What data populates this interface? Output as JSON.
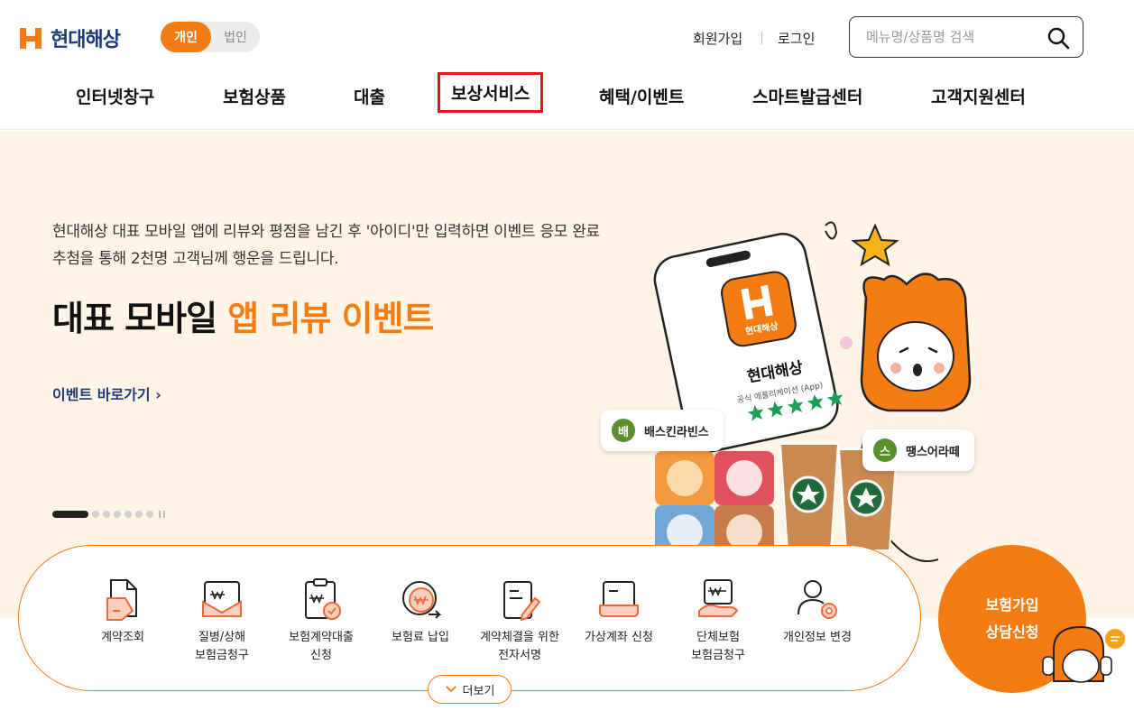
{
  "brand": {
    "name": "현대해상",
    "color": "#f47c12",
    "navy": "#1d3c78"
  },
  "segment": {
    "personal": "개인",
    "corporate": "법인"
  },
  "utility": {
    "join": "회원가입",
    "login": "로그인"
  },
  "search": {
    "placeholder": "메뉴명/상품명 검색",
    "icon": "search-icon"
  },
  "gnb": [
    {
      "label": "인터넷창구"
    },
    {
      "label": "보험상품"
    },
    {
      "label": "대출"
    },
    {
      "label": "보상서비스"
    },
    {
      "label": "혜택/이벤트"
    },
    {
      "label": "스마트발급센터"
    },
    {
      "label": "고객지원센터"
    }
  ],
  "hero": {
    "desc_line1": "현대해상 대표 모바일 앱에 리뷰와 평점을 남긴 후 '아이디'만 입력하면 이벤트 응모 완료",
    "desc_line2": "추첨을 통해 2천명 고객님께 행운을 드립니다.",
    "title_plain": "대표 모바일 ",
    "title_accent": "앱 리뷰 이벤트",
    "link": "이벤트 바로가기",
    "slide_count": 8,
    "current_slide": 1,
    "art": {
      "app_name": "현대해상",
      "app_sub": "공식 애플리케이션 (App)",
      "logo_text": "현대해상",
      "rating_stars": 5,
      "chip1": {
        "initial": "배",
        "label": "배스킨라빈스"
      },
      "chip2": {
        "initial": "스",
        "label": "땡스어라떼"
      }
    }
  },
  "quick_menu": [
    {
      "label": "계약조회",
      "icon": "document-icon"
    },
    {
      "label": "질병/상해\n보험금청구",
      "icon": "won-envelope-icon"
    },
    {
      "label": "보험계약대출\n신청",
      "icon": "clipboard-won-icon"
    },
    {
      "label": "보험료 납입",
      "icon": "won-payment-icon"
    },
    {
      "label": "계약체결을 위한\n전자서명",
      "icon": "sign-document-icon"
    },
    {
      "label": "가상계좌 신청",
      "icon": "card-hand-icon"
    },
    {
      "label": "단체보험\n보험금청구",
      "icon": "group-won-icon"
    },
    {
      "label": "개인정보 변경",
      "icon": "user-gear-icon"
    }
  ],
  "more": {
    "label": "더보기"
  },
  "consult": {
    "line1": "보험가입",
    "line2": "상담신청"
  }
}
